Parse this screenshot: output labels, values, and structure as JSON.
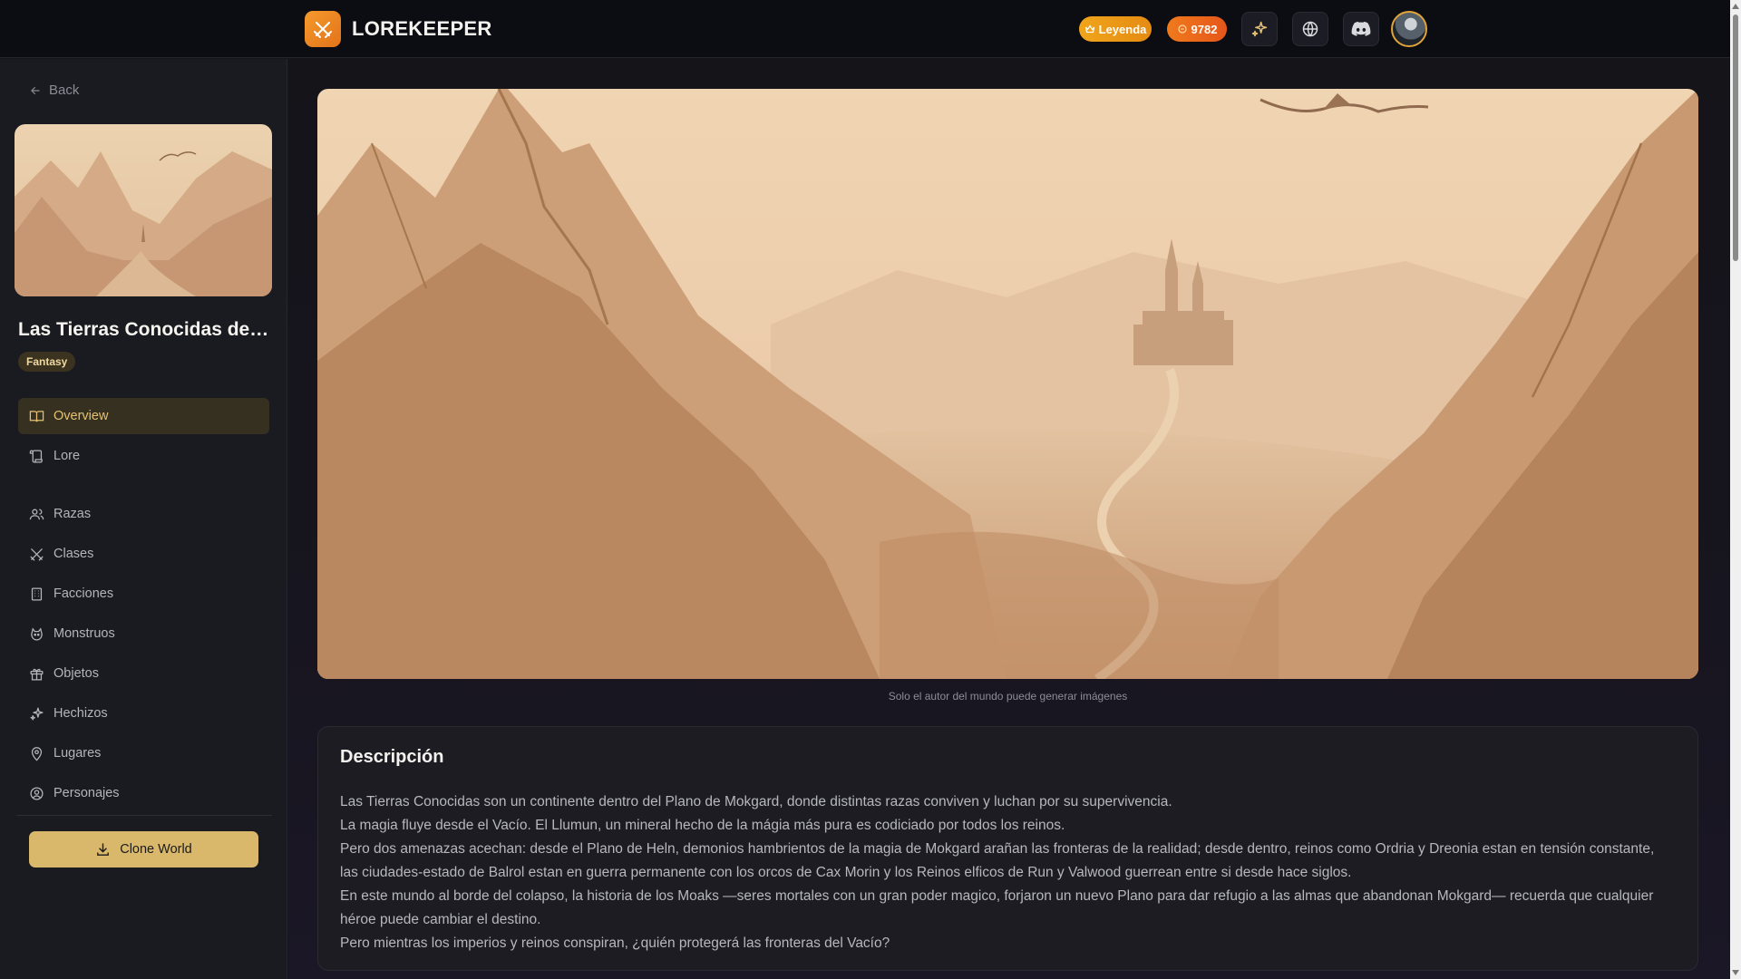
{
  "app": {
    "name": "LOREKEEPER"
  },
  "header": {
    "rank_label": "Leyenda",
    "coins": "9782",
    "icons": [
      "sparkles-icon",
      "globe-icon",
      "discord-icon"
    ]
  },
  "sidebar": {
    "back_label": "Back",
    "world_title": "Las Tierras Conocidas de Mokgard",
    "genre": "Fantasy",
    "nav_primary": [
      {
        "label": "Overview",
        "icon": "book-open-icon",
        "active": true
      },
      {
        "label": "Lore",
        "icon": "scroll-icon",
        "active": false
      }
    ],
    "nav_sections": [
      {
        "label": "Razas",
        "icon": "users-icon"
      },
      {
        "label": "Clases",
        "icon": "crossed-swords-icon"
      },
      {
        "label": "Facciones",
        "icon": "building-icon"
      },
      {
        "label": "Monstruos",
        "icon": "monster-icon"
      },
      {
        "label": "Objetos",
        "icon": "gift-icon"
      },
      {
        "label": "Hechizos",
        "icon": "sparkles-icon"
      },
      {
        "label": "Lugares",
        "icon": "map-pin-icon"
      },
      {
        "label": "Personajes",
        "icon": "user-circle-icon"
      }
    ],
    "clone_label": "Clone World"
  },
  "main": {
    "image_caption": "Solo el autor del mundo puede generar imágenes",
    "description": {
      "title": "Descripción",
      "paragraphs": [
        "Las Tierras Conocidas son un continente dentro del Plano de Mokgard, donde distintas razas conviven y luchan por su supervivencia.",
        "La magia fluye desde el Vacío. El Llumun, un mineral hecho de la mágia más pura es codiciado por todos los reinos.",
        "Pero dos amenazas acechan: desde el Plano de Heln, demonios hambrientos de la magia de Mokgard arañan las fronteras de la realidad; desde dentro, reinos como Ordria y Dreonia estan en tensión constante, las ciudades-estado de Balrol estan en guerra permanente con los orcos de Cax Morin y los Reinos elficos de Run y Valwood guerrean entre si desde hace siglos.",
        "En este mundo al borde del colapso, la historia de los Moaks —seres mortales con un gran poder magico, forjaron un nuevo Plano para dar refugio a las almas que abandonan Mokgard— recuerda que cualquier héroe puede cambiar el destino.",
        "Pero mientras los imperios y reinos conspiran, ¿quién protegerá las fronteras del Vacío?"
      ]
    }
  },
  "colors": {
    "accent": "#d9b86b",
    "brand_orange": "#f08a24",
    "background": "#15151c",
    "sidebar": "#1a1b21"
  }
}
